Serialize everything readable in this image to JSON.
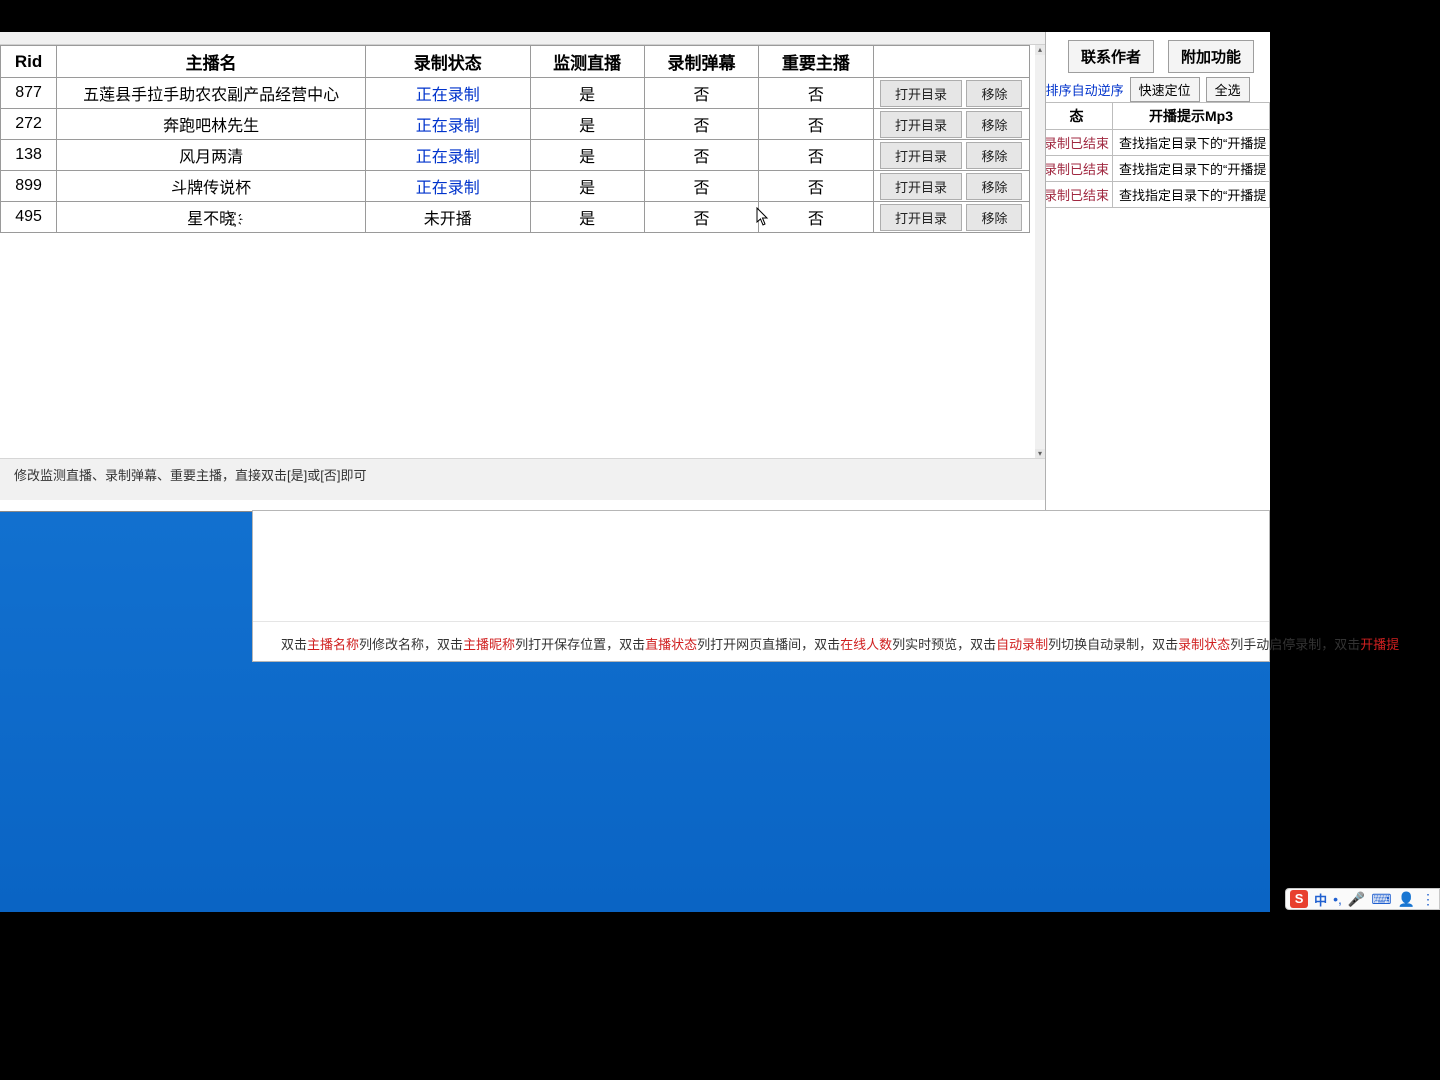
{
  "main_table": {
    "headers": [
      "Rid",
      "主播名",
      "录制状态",
      "监测直播",
      "录制弹幕",
      "重要主播",
      ""
    ],
    "rows": [
      {
        "rid": "877",
        "name": "五莲县手拉手助农农副产品经营中心",
        "status": "正在录制",
        "status_style": "blue",
        "monitor": "是",
        "danmu": "否",
        "vip": "否"
      },
      {
        "rid": "272",
        "name": "奔跑吧林先生",
        "status": "正在录制",
        "status_style": "blue",
        "monitor": "是",
        "danmu": "否",
        "vip": "否"
      },
      {
        "rid": "138",
        "name": "风月两清",
        "status": "正在录制",
        "status_style": "blue",
        "monitor": "是",
        "danmu": "否",
        "vip": "否"
      },
      {
        "rid": "899",
        "name": "斗牌传说杯",
        "status": "正在录制",
        "status_style": "blue",
        "monitor": "是",
        "danmu": "否",
        "vip": "否"
      },
      {
        "rid": "495",
        "name": "星不晓҉҉",
        "status": "未开播",
        "status_style": "plain",
        "monitor": "是",
        "danmu": "否",
        "vip": "否"
      }
    ],
    "open_dir_label": "打开目录",
    "remove_label": "移除"
  },
  "hint_bar": "修改监测直播、录制弹幕、重要主播，直接双击[是]或[否]即可",
  "under_hint": {
    "segments": [
      {
        "t": "双击",
        "c": ""
      },
      {
        "t": "主播名称",
        "c": "red"
      },
      {
        "t": "列修改名称，双击",
        "c": ""
      },
      {
        "t": "主播昵称",
        "c": "red"
      },
      {
        "t": "列打开保存位置，双击",
        "c": ""
      },
      {
        "t": "直播状态",
        "c": "red"
      },
      {
        "t": "列打开网页直播间，双击",
        "c": ""
      },
      {
        "t": "在线人数",
        "c": "red"
      },
      {
        "t": "列实时预览，双击",
        "c": ""
      },
      {
        "t": "自动录制",
        "c": "red"
      },
      {
        "t": "列切换自动录制，双击",
        "c": ""
      },
      {
        "t": "录制状态",
        "c": "red"
      },
      {
        "t": "列手动启停录制，双击",
        "c": ""
      },
      {
        "t": "开播提",
        "c": "red"
      }
    ]
  },
  "side": {
    "btn_contact": "联系作者",
    "btn_extra": "附加功能",
    "sort_hint": ";排序自动逆序",
    "btn_locate": "快速定位",
    "btn_select_all": "全选",
    "headers": [
      "态",
      "开播提示Mp3"
    ],
    "rows": [
      {
        "state": "录制已结束",
        "mp3": "查找指定目录下的“开播提"
      },
      {
        "state": "录制已结束",
        "mp3": "查找指定目录下的“开播提"
      },
      {
        "state": "录制已结束",
        "mp3": "查找指定目录下的“开播提"
      }
    ]
  },
  "ime": {
    "s": "S",
    "zh": "中"
  }
}
